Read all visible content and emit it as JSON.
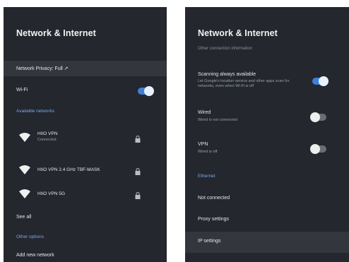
{
  "left": {
    "title": "Network & Internet",
    "privacy_row": "Network Privacy: Full ↗",
    "wifi_label": "Wi-Fi",
    "wifi_on": true,
    "available_section": "Available networks",
    "networks": [
      {
        "name": "HIIO VPN",
        "status": "Connected",
        "secured": true
      },
      {
        "name": "HIIO VPN 2.4 GHz TBF-MASK",
        "status": "",
        "secured": true
      },
      {
        "name": "HIIO VPN 5G",
        "status": "",
        "secured": true
      }
    ],
    "see_all": "See all",
    "other_options_section": "Other options",
    "add_network": "Add new network"
  },
  "right": {
    "title": "Network & Internet",
    "subtitle": "Other connection information",
    "scanning_label": "Scanning always available",
    "scanning_sub": "Let Google's location service and other apps scan for networks, even when Wi-Fi is off",
    "scanning_on": true,
    "wired_label": "Wired",
    "wired_sub": "Wired is not connected",
    "wired_on": false,
    "vpn_label": "VPN",
    "vpn_sub": "Wired is off",
    "vpn_on": false,
    "ethernet_section": "Ethernet",
    "not_connected": "Not connected",
    "proxy_settings": "Proxy settings",
    "ip_settings": "IP settings"
  },
  "colors": {
    "panel_bg": "#24272d",
    "highlight_bg": "#33363c",
    "accent": "#7fa7ea",
    "toggle_on": "#3f7fd6"
  }
}
